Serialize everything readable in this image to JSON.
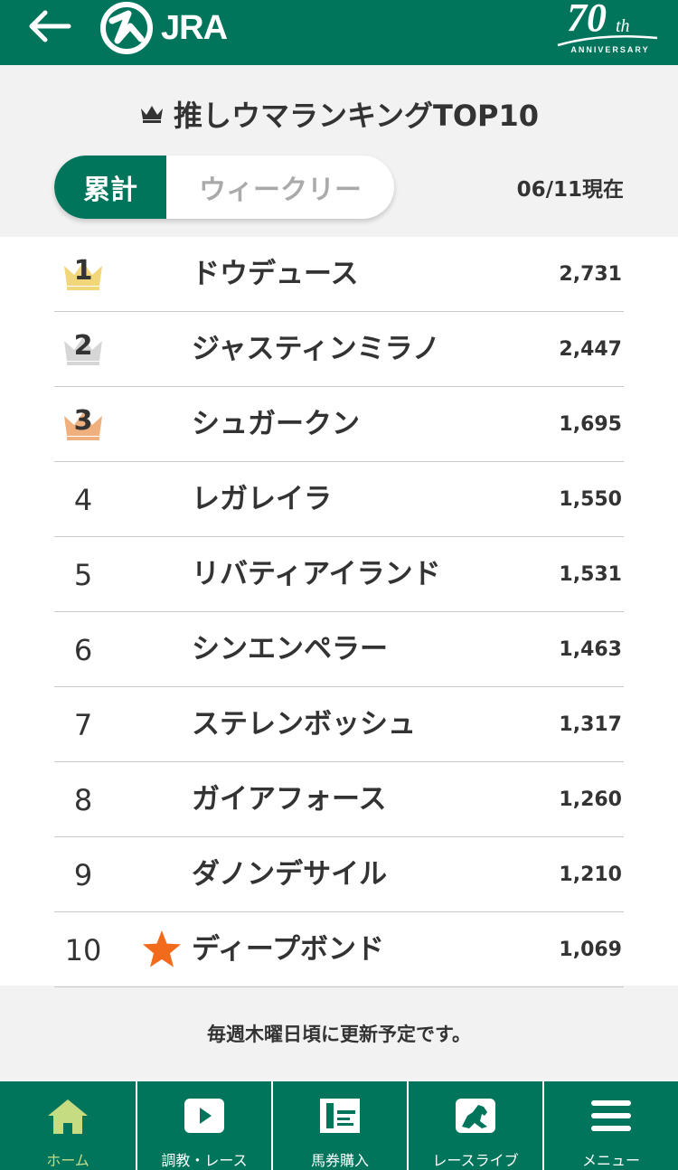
{
  "header": {
    "logo_text": "JRA",
    "anniversary_number": "70",
    "anniversary_suffix": "th",
    "anniversary_text": "ANNIVERSARY"
  },
  "title": "推しウマランキングTOP10",
  "tabs": [
    {
      "label": "累計",
      "active": true
    },
    {
      "label": "ウィークリー",
      "active": false
    }
  ],
  "as_of": "06/11現在",
  "ranking": [
    {
      "rank": "1",
      "name": "ドウデュース",
      "votes": "2,731",
      "crown": "gold"
    },
    {
      "rank": "2",
      "name": "ジャスティンミラノ",
      "votes": "2,447",
      "crown": "silver"
    },
    {
      "rank": "3",
      "name": "シュガークン",
      "votes": "1,695",
      "crown": "bronze"
    },
    {
      "rank": "4",
      "name": "レガレイラ",
      "votes": "1,550"
    },
    {
      "rank": "5",
      "name": "リバティアイランド",
      "votes": "1,531"
    },
    {
      "rank": "6",
      "name": "シンエンペラー",
      "votes": "1,463"
    },
    {
      "rank": "7",
      "name": "ステレンボッシュ",
      "votes": "1,317"
    },
    {
      "rank": "8",
      "name": "ガイアフォース",
      "votes": "1,260"
    },
    {
      "rank": "9",
      "name": "ダノンデサイル",
      "votes": "1,210"
    },
    {
      "rank": "10",
      "name": "ディープボンド",
      "votes": "1,069",
      "starred": true
    }
  ],
  "note": "毎週木曜日頃に更新予定です。",
  "nav": [
    {
      "label": "ホーム",
      "icon": "home-icon",
      "active": true
    },
    {
      "label": "調教・レース",
      "icon": "play-icon",
      "active": false
    },
    {
      "label": "馬券購入",
      "icon": "ticket-icon",
      "active": false
    },
    {
      "label": "レースライブ",
      "icon": "horse-icon",
      "active": false
    },
    {
      "label": "メニュー",
      "icon": "menu-icon",
      "active": false
    }
  ],
  "colors": {
    "brand_green": "#00755c",
    "gold_crown": "#f2d67a",
    "silver_crown": "#d6d6d6",
    "bronze_crown": "#f0b07d",
    "star": "#f26b1d",
    "active_nav_label": "#c5dc83"
  }
}
